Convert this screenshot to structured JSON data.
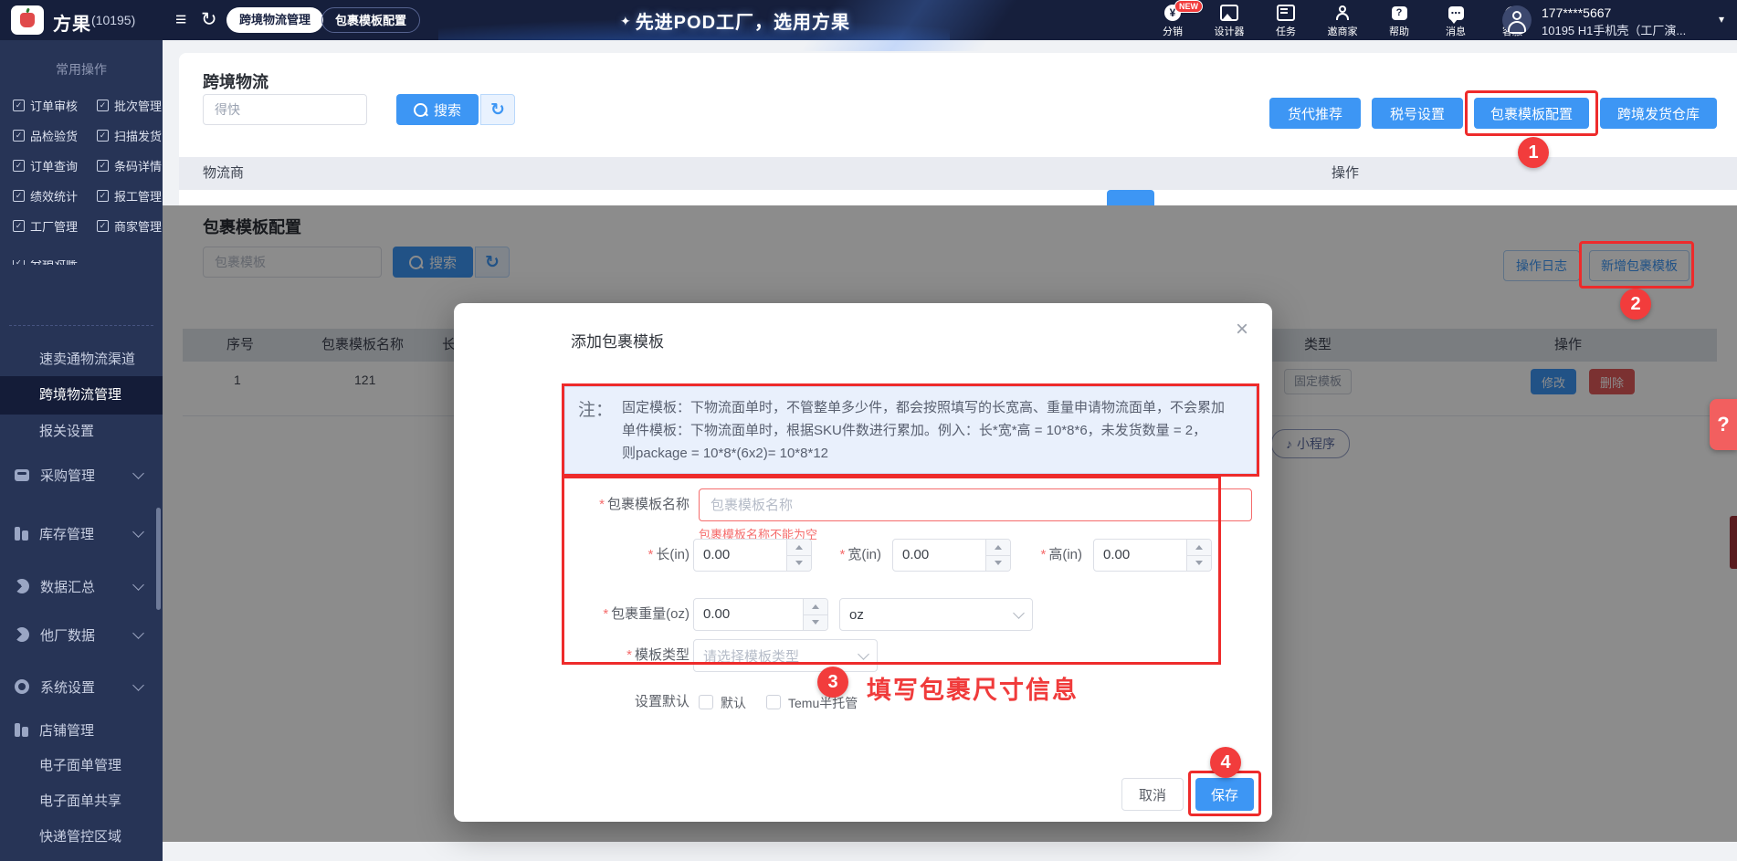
{
  "icons": {
    "hamburger": "≡",
    "refresh": "↻",
    "slogan_star": "✦",
    "yen": "¥",
    "question": "?",
    "close": "×",
    "caret_down": "▾",
    "ellipsis": "⋯",
    "check": "✓",
    "music": "♪"
  },
  "topbar": {
    "brand": "方果",
    "brand_code": "(10195)",
    "tab_active": "跨境物流管理",
    "tab_secondary": "包裹模板配置",
    "slogan": "先进POD工厂，选用方果",
    "new_badge": "NEW",
    "nav_items": [
      {
        "label": "分销"
      },
      {
        "label": "设计器"
      },
      {
        "label": "任务"
      },
      {
        "label": "邀商家"
      },
      {
        "label": "帮助"
      },
      {
        "label": "消息"
      },
      {
        "label": "客服"
      }
    ],
    "user_phone": "177****5667",
    "user_org": "10195 H1手机壳（工厂演..."
  },
  "sidebar": {
    "section_title": "常用操作",
    "quick_links": [
      "订单审核",
      "批次管理",
      "品检验货",
      "扫描发货",
      "订单查询",
      "条码详情",
      "绩效统计",
      "报工管理",
      "工厂管理",
      "商家管理",
      "分销对账"
    ],
    "plain_items": [
      "速卖通物流渠道",
      "跨境物流管理",
      "报关设置"
    ],
    "groups": [
      "采购管理",
      "库存管理",
      "数据汇总",
      "他厂数据",
      "系统设置",
      "店铺管理"
    ],
    "shop_children": [
      "电子面单管理",
      "电子面单共享",
      "快递管控区域"
    ]
  },
  "logistics": {
    "title": "跨境物流",
    "search_value": "得快",
    "search_button": "搜索",
    "action_buttons": [
      "货代推荐",
      "税号设置",
      "包裹模板配置",
      "跨境发货仓库"
    ],
    "col_provider": "物流商",
    "col_action": "操作"
  },
  "panel": {
    "title": "包裹模板配置",
    "search_placeholder": "包裹模板",
    "search_button": "搜索",
    "log_button": "操作日志",
    "add_button": "新增包裹模板",
    "columns": [
      "序号",
      "包裹模板名称",
      "长",
      "类型",
      "操作"
    ],
    "row": {
      "index": "1",
      "name": "121",
      "type": "固定模板",
      "edit": "修改",
      "delete": "删除"
    },
    "miniprogram": "小程序"
  },
  "modal": {
    "title": "添加包裹模板",
    "note_prefix": "注：",
    "note_line1": "固定模板：下物流面单时，不管整单多少件，都会按照填写的长宽高、重量申请物流面单，不会累加",
    "note_line2": "单件模板：下物流面单时，根据SKU件数进行累加。例入：长*宽*高 = 10*8*6，未发货数量 = 2，",
    "note_line3": "则package = 10*8*(6x2)= 10*8*12",
    "required_mark": "*",
    "name_label": "包裹模板名称",
    "name_placeholder": "包裹模板名称",
    "name_error": "包裹模板名称不能为空",
    "length_label": "长(in)",
    "width_label": "宽(in)",
    "height_label": "高(in)",
    "dim_value": "0.00",
    "weight_label": "包裹重量(oz)",
    "weight_value": "0.00",
    "unit_value": "oz",
    "type_label": "模板类型",
    "type_placeholder": "请选择模板类型",
    "default_label": "设置默认",
    "checkbox_default": "默认",
    "checkbox_temu": "Temu半托管",
    "cancel_button": "取消",
    "save_button": "保存"
  },
  "annotations": {
    "step1": "1",
    "step2": "2",
    "step3": "3",
    "step4": "4",
    "step3_text": "填写包裹尺寸信息"
  },
  "colors": {
    "accent": "#3d96f4",
    "annotation_red": "#ee2b2b",
    "topbar_bg": "#161f3c",
    "sidebar_bg": "#273456"
  }
}
